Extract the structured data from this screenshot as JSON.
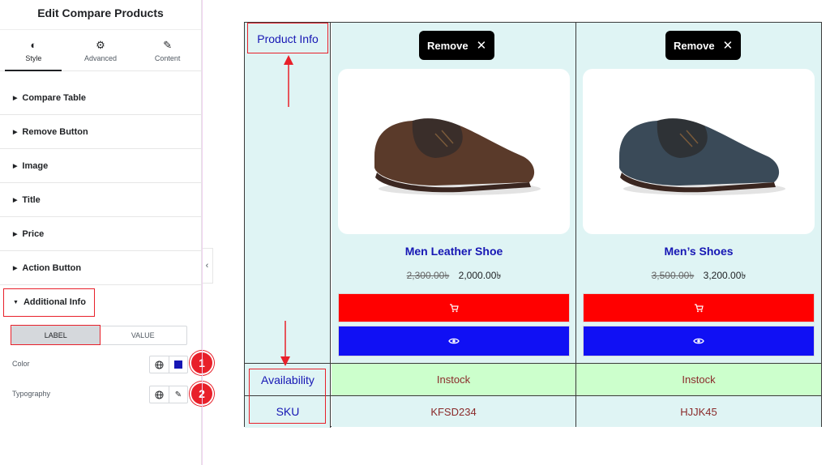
{
  "panel": {
    "title": "Edit Compare Products",
    "tabs": [
      {
        "label": "Style",
        "icon": "half-circle-icon"
      },
      {
        "label": "Advanced",
        "icon": "gear-icon"
      },
      {
        "label": "Content",
        "icon": "pencil-icon"
      }
    ],
    "sections": [
      "Compare Table",
      "Remove Button",
      "Image",
      "Title",
      "Price",
      "Action Button",
      "Additional Info"
    ],
    "toggle": {
      "label": "LABEL",
      "value": "VALUE"
    },
    "controls": {
      "color_label": "Color",
      "typography_label": "Typography"
    },
    "badges": [
      "1",
      "2"
    ],
    "swatch_color": "#1616b4"
  },
  "table": {
    "labels": {
      "product_info": "Product Info",
      "availability": "Availability",
      "sku": "SKU"
    },
    "remove_label": "Remove",
    "products": [
      {
        "title": "Men Leather Shoe",
        "old_price": "2,300.00৳",
        "price": "2,000.00৳",
        "availability": "Instock",
        "sku": "KFSD234",
        "shoe_color": "#5a3a2a"
      },
      {
        "title": "Men’s Shoes",
        "old_price": "3,500.00৳",
        "price": "3,200.00৳",
        "availability": "Instock",
        "sku": "HJJK45",
        "shoe_color": "#3a4a58"
      }
    ]
  },
  "colors": {
    "accent_red": "#e8202a",
    "label_blue": "#1616b4",
    "cart_red": "#ff0000",
    "view_blue": "#1010f4",
    "cell_bg": "#dff4f4",
    "avail_bg": "#ccffcc"
  }
}
